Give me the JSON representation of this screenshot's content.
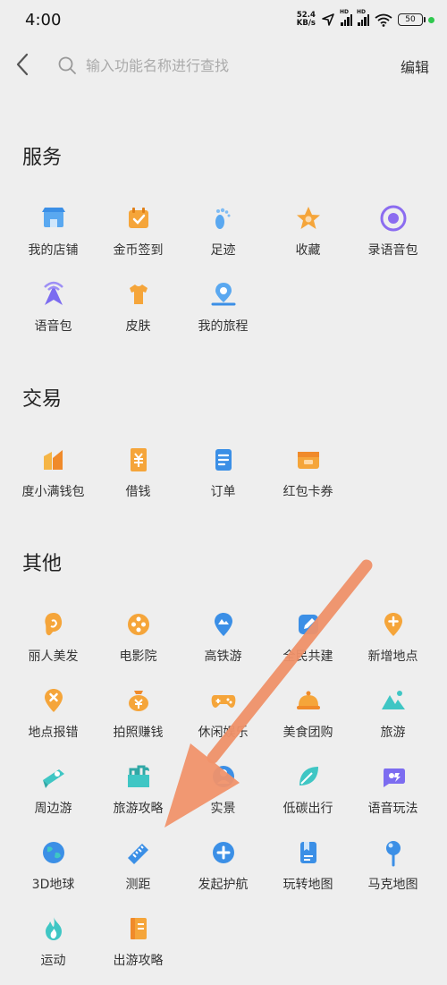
{
  "status": {
    "time": "4:00",
    "speed_value": "52.4",
    "speed_unit": "KB/s",
    "network_tag_1": "HD",
    "network_tag_2": "HD",
    "battery": "50"
  },
  "header": {
    "search_placeholder": "输入功能名称进行查找",
    "edit_label": "编辑"
  },
  "sections": [
    {
      "title": "服务",
      "items": [
        {
          "label": "我的店铺",
          "icon": "store-icon"
        },
        {
          "label": "金币签到",
          "icon": "checkin-icon"
        },
        {
          "label": "足迹",
          "icon": "footprint-icon"
        },
        {
          "label": "收藏",
          "icon": "star-icon"
        },
        {
          "label": "录语音包",
          "icon": "record-icon"
        },
        {
          "label": "语音包",
          "icon": "voice-pack-icon"
        },
        {
          "label": "皮肤",
          "icon": "skin-icon"
        },
        {
          "label": "我的旅程",
          "icon": "journey-icon"
        }
      ]
    },
    {
      "title": "交易",
      "items": [
        {
          "label": "度小满钱包",
          "icon": "wallet-icon"
        },
        {
          "label": "借钱",
          "icon": "loan-icon"
        },
        {
          "label": "订单",
          "icon": "order-icon"
        },
        {
          "label": "红包卡券",
          "icon": "coupon-icon"
        }
      ]
    },
    {
      "title": "其他",
      "items": [
        {
          "label": "丽人美发",
          "icon": "hair-icon"
        },
        {
          "label": "电影院",
          "icon": "cinema-icon"
        },
        {
          "label": "高铁游",
          "icon": "train-travel-icon"
        },
        {
          "label": "全民共建",
          "icon": "co-build-icon"
        },
        {
          "label": "新增地点",
          "icon": "add-place-icon"
        },
        {
          "label": "地点报错",
          "icon": "report-place-icon"
        },
        {
          "label": "拍照赚钱",
          "icon": "photo-earn-icon"
        },
        {
          "label": "休闲娱乐",
          "icon": "game-icon"
        },
        {
          "label": "美食团购",
          "icon": "food-icon"
        },
        {
          "label": "旅游",
          "icon": "travel-icon"
        },
        {
          "label": "周边游",
          "icon": "nearby-travel-icon"
        },
        {
          "label": "旅游攻略",
          "icon": "travel-guide-icon"
        },
        {
          "label": "实景",
          "icon": "street-view-icon"
        },
        {
          "label": "低碳出行",
          "icon": "low-carbon-icon"
        },
        {
          "label": "语音玩法",
          "icon": "voice-play-icon"
        },
        {
          "label": "3D地球",
          "icon": "globe-icon"
        },
        {
          "label": "测距",
          "icon": "ruler-icon"
        },
        {
          "label": "发起护航",
          "icon": "escort-icon"
        },
        {
          "label": "玩转地图",
          "icon": "map-guide-icon"
        },
        {
          "label": "马克地图",
          "icon": "pin-map-icon"
        },
        {
          "label": "运动",
          "icon": "sport-icon"
        },
        {
          "label": "出游攻略",
          "icon": "trip-guide-icon"
        }
      ]
    }
  ],
  "annotation": {
    "color": "#f0926a",
    "icon": "annotation-arrow-icon"
  }
}
